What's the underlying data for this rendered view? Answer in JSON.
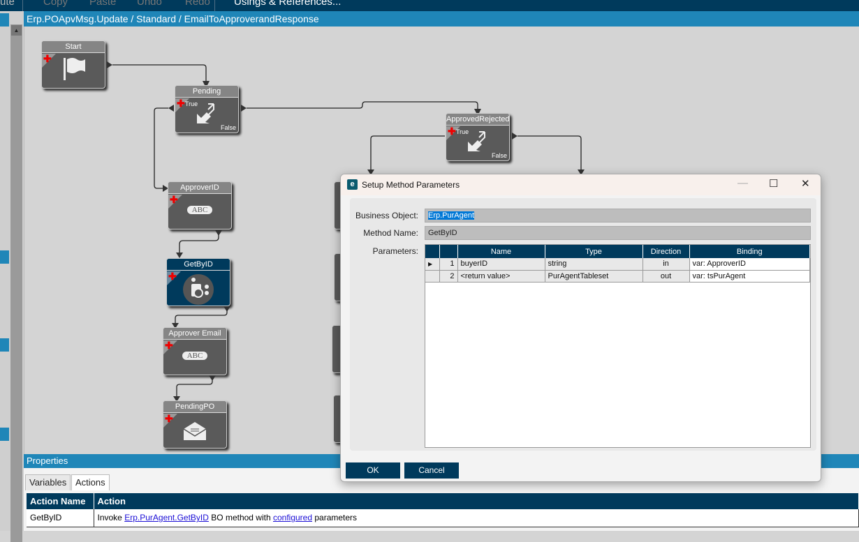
{
  "toolbar": {
    "items": [
      "ute",
      "Copy",
      "Paste",
      "Undo",
      "Redo",
      "Usings & References..."
    ]
  },
  "breadcrumb": "Erp.POApvMsg.Update / Standard / EmailToApproverandResponse",
  "nodes": {
    "start": "Start",
    "pending": "Pending",
    "approved_rejected": "ApprovedRejected",
    "approver_id": "ApproverID",
    "get_by_id": "GetByID",
    "approver_email": "Approver Email",
    "pending_po": "PendingPO",
    "true_label": "True",
    "false_label": "False",
    "abc": "ABC"
  },
  "properties": {
    "title": "Properties",
    "tabs": [
      "Variables",
      "Actions"
    ],
    "active_tab": "Actions",
    "columns": [
      "Action Name",
      "Action"
    ],
    "rows": [
      {
        "name": "GetByID",
        "prefix": "Invoke ",
        "link1": "Erp.PurAgent.GetByID",
        "mid": " BO method with ",
        "link2": "configured",
        "suffix": " parameters"
      }
    ]
  },
  "dialog": {
    "title": "Setup Method Parameters",
    "business_object_label": "Business Object:",
    "business_object": "Erp.PurAgent",
    "method_name_label": "Method Name:",
    "method_name": "GetByID",
    "parameters_label": "Parameters:",
    "columns": [
      "",
      "",
      "Name",
      "Type",
      "Direction",
      "Binding"
    ],
    "rows": [
      {
        "n": "1",
        "name": "buyerID",
        "type": "string",
        "direction": "in",
        "binding": "var: ApproverID"
      },
      {
        "n": "2",
        "name": "<return value>",
        "type": "PurAgentTableset",
        "direction": "out",
        "binding": "var: tsPurAgent"
      }
    ],
    "ok": "OK",
    "cancel": "Cancel"
  }
}
